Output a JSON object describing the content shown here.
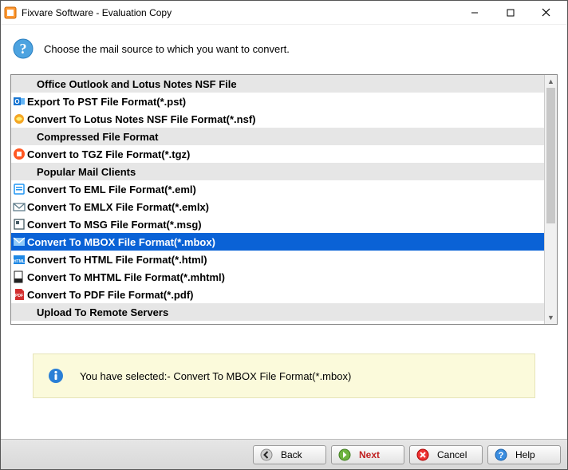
{
  "titlebar": {
    "title": "Fixvare Software - Evaluation Copy"
  },
  "header": {
    "prompt": "Choose the mail source to which you want to convert."
  },
  "list": {
    "rows": [
      {
        "type": "group",
        "label": "Office Outlook and Lotus Notes NSF File"
      },
      {
        "type": "item",
        "icon": "outlook",
        "label": "Export To PST File Format(*.pst)",
        "selected": false
      },
      {
        "type": "item",
        "icon": "notes",
        "label": "Convert To Lotus Notes NSF File Format(*.nsf)",
        "selected": false
      },
      {
        "type": "group",
        "label": "Compressed File Format"
      },
      {
        "type": "item",
        "icon": "tgz",
        "label": "Convert to TGZ File Format(*.tgz)",
        "selected": false
      },
      {
        "type": "group",
        "label": "Popular Mail Clients"
      },
      {
        "type": "item",
        "icon": "eml",
        "label": "Convert To EML File Format(*.eml)",
        "selected": false
      },
      {
        "type": "item",
        "icon": "emlx",
        "label": "Convert To EMLX File Format(*.emlx)",
        "selected": false
      },
      {
        "type": "item",
        "icon": "msg",
        "label": "Convert To MSG File Format(*.msg)",
        "selected": false
      },
      {
        "type": "item",
        "icon": "mbox",
        "label": "Convert To MBOX File Format(*.mbox)",
        "selected": true
      },
      {
        "type": "item",
        "icon": "html",
        "label": "Convert To HTML File Format(*.html)",
        "selected": false
      },
      {
        "type": "item",
        "icon": "mhtml",
        "label": "Convert To MHTML File Format(*.mhtml)",
        "selected": false
      },
      {
        "type": "item",
        "icon": "pdf",
        "label": "Convert To PDF File Format(*.pdf)",
        "selected": false
      },
      {
        "type": "group",
        "label": "Upload To Remote Servers"
      }
    ]
  },
  "status": {
    "text": "You have selected:- Convert To MBOX File Format(*.mbox)"
  },
  "footer": {
    "back": "Back",
    "next": "Next",
    "cancel": "Cancel",
    "help": "Help"
  },
  "iconColors": {
    "outlook": "#1976d2",
    "notes": "#f5a623",
    "tgz": "#ff5722",
    "eml": "#2196f3",
    "emlx": "#607d8b",
    "msg": "#455a64",
    "mbox": "#90caf9",
    "html": "#1e88e5",
    "mhtml": "#212121",
    "pdf": "#d32f2f"
  }
}
